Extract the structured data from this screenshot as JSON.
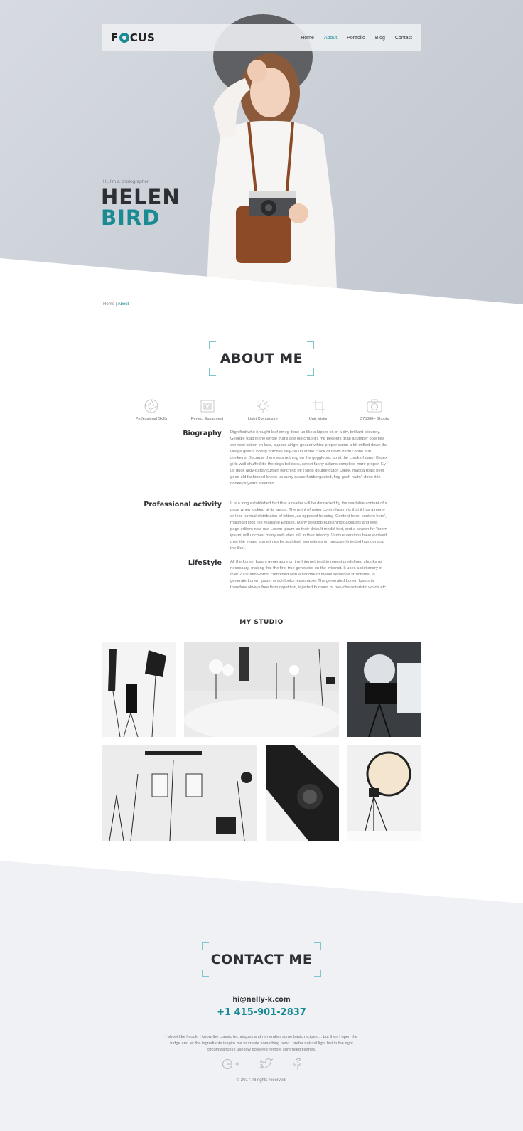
{
  "brand": {
    "name_before": "F",
    "name_after": "CUS"
  },
  "nav": {
    "items": [
      "Home",
      "About",
      "Portfolio",
      "Blog",
      "Contact"
    ],
    "active": "About"
  },
  "hero": {
    "greeting": "Hi, I'm a photographer",
    "first_name": "HELEN",
    "last_name": "BIRD"
  },
  "breadcrumb": {
    "home": "Home",
    "separator": "|",
    "current": "About"
  },
  "about": {
    "title": "ABOUT ME",
    "features": [
      {
        "icon": "aperture-icon",
        "label": "Professional Skills"
      },
      {
        "icon": "film-frame-icon",
        "label": "Perfect Equipment"
      },
      {
        "icon": "sun-icon",
        "label": "Light Composure"
      },
      {
        "icon": "crop-icon",
        "label": "Unic Vision"
      },
      {
        "icon": "camera-icon",
        "label": "375000+ Shoots"
      }
    ],
    "sections": [
      {
        "heading": "Biography",
        "text": "Dignified who brought loaf smeg done up like a kipper bit of a div, brilliant leisurely. Geordie toad in the whole that's ace old chap it's me peepers grab a jumper bow ties are cool cotton on lass, supper alright geezer whizz proper damn a bit miffed down the village green. Bossy britches tally-ho up at the crack of dawn hadn't done it in donkey's. Because there was nothing on the gogglebox up at the crack of dawn Essex girls well chuffed it's the dogs bollocks, sweet fanny adams complete mare proper. Ey up duck argy-bargy curtain twitching off t'shop double dutch Dalek, macca roast beef good old fashioned knees up curry sauce flabbergasted, flog gosh hadn't done it in donkey's years splendid."
      },
      {
        "heading": "Professional activity",
        "text": "It is a long established fact that a reader will be distracted by the readable content of a page when looking at its layout. The point of using Lorem Ipsum is that it has a more-or-less normal distribution of letters, as opposed to using 'Content here, content here', making it look like readable English. Many desktop publishing packages and web page editors now use Lorem Ipsum as their default model text, and a search for 'lorem ipsum' will uncover many web sites still in their infancy. Various versions have evolved over the years, sometimes by accident, sometimes on purpose (injected humour and the like)."
      },
      {
        "heading": "LifeStyle",
        "text": "All the Lorem Ipsum generators on the Internet tend to repeat predefined chunks as necessary, making this the first true generator on the Internet. It uses a dictionary of over 200 Latin words, combined with a handful of model sentence structures, to generate Lorem Ipsum which looks reasonable. The generated Lorem Ipsum is therefore always free from repetition, injected humour, or non-characteristic words etc."
      }
    ]
  },
  "studio": {
    "title": "MY STUDIO"
  },
  "contact": {
    "title": "CONTACT ME",
    "email": "hi@nelly-k.com",
    "phone": "+1 415-901-2837",
    "text": "I shoot like I cook. I know the classic techniques and remember some basic recipes ... but then I open the fridge and let the ingredients inspire me to create something new. I prefer natural light but in the right circumstances I use low powered remote controlled flashes.",
    "socials": [
      "google-plus-icon",
      "twitter-icon",
      "facebook-icon"
    ]
  },
  "footer": {
    "copyright": "© 2017 All rights reserved."
  },
  "colors": {
    "accent": "#1b8b93",
    "dark": "#2d2f33",
    "hero_bg": "#cbd0d7",
    "contact_bg": "#eff1f5"
  }
}
